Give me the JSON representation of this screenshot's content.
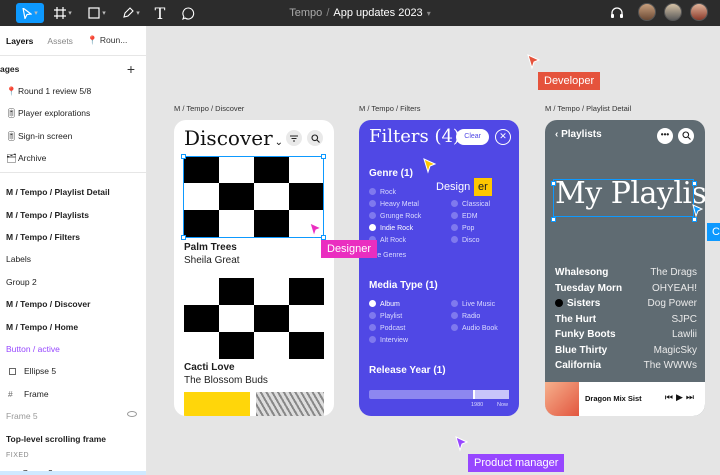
{
  "toolbar": {
    "project": "Tempo",
    "file": "App updates 2023",
    "text_tool": "T"
  },
  "left_panel": {
    "tabs": [
      "Layers",
      "Assets",
      "Roun..."
    ],
    "pages_label": "ages",
    "pages": [
      {
        "icon": "📍",
        "label": "Round 1 review 5/8"
      },
      {
        "icon": "🎚",
        "label": "Player explorations"
      },
      {
        "icon": "🎚",
        "label": "Sign-in screen"
      },
      {
        "icon": "🗂",
        "label": "Archive"
      }
    ],
    "layers": [
      {
        "label": "M / Tempo / Playlist Detail",
        "style": "bold"
      },
      {
        "label": "M / Tempo / Playlists",
        "style": "bold"
      },
      {
        "label": "M / Tempo / Filters",
        "style": "bold"
      },
      {
        "label": "Labels",
        "style": "normal"
      },
      {
        "label": "Group 2",
        "style": "normal"
      },
      {
        "label": "M / Tempo / Discover",
        "style": "bold"
      },
      {
        "label": "M / Tempo / Home",
        "style": "bold"
      },
      {
        "label": "Button / active",
        "style": "purple"
      },
      {
        "label": "Ellipse 5",
        "style": "normal"
      },
      {
        "label": "Frame",
        "style": "normal"
      },
      {
        "label": "Frame 5",
        "style": "grey"
      },
      {
        "label": "Top-level scrolling frame",
        "style": "hdr"
      },
      {
        "label": "FIXED",
        "style": "small"
      },
      {
        "label": "Group 2",
        "style": "normal"
      }
    ]
  },
  "canvas": {
    "frame_labels": [
      "M / Tempo / Discover",
      "M / Tempo / Filters",
      "M / Tempo / Playlist Detail"
    ],
    "discover": {
      "title": "Discover",
      "songs": [
        {
          "title": "Palm Trees",
          "artist": "Sheila Great"
        },
        {
          "title": "Cacti Love",
          "artist": "The Blossom Buds"
        }
      ]
    },
    "filters": {
      "title": "Filters (4)",
      "clear": "Clear",
      "genre_title": "Genre (1)",
      "genre_left": [
        "Rock",
        "Heavy Metal",
        "Grunge Rock",
        "Indie Rock",
        "Alt Rock"
      ],
      "genre_right": [
        "Classical",
        "EDM",
        "Pop",
        "Disco"
      ],
      "more_genres": "re Genres",
      "media_title": "Media Type (1)",
      "media_left": [
        "Album",
        "Playlist",
        "Podcast",
        "Interview"
      ],
      "media_right": [
        "Live Music",
        "Radio",
        "Audio Book"
      ],
      "release_title": "Release Year (1)",
      "slider_low": "1980",
      "slider_high": "Now"
    },
    "playlist": {
      "back": "Playlists",
      "more": "•••",
      "title": "My Playlist",
      "tracks": [
        {
          "title": "Whalesong",
          "artist": "The Drags"
        },
        {
          "title": "Tuesday Morn",
          "artist": "OHYEAH!"
        },
        {
          "title": "Sisters",
          "artist": "Dog Power"
        },
        {
          "title": "The Hurt",
          "artist": "SJPC"
        },
        {
          "title": "Funky Boots",
          "artist": "Lawlii"
        },
        {
          "title": "Blue Thirty",
          "artist": "MagicSky"
        },
        {
          "title": "California",
          "artist": "The WWWs"
        }
      ],
      "now_playing": "Dragon Mix Sist",
      "controls": "⏮▶⏭"
    },
    "cursors": {
      "developer": "Developer",
      "designer_pink": "Designer",
      "designer_yellow": "Design",
      "designer_yellow_cut": "er",
      "product_manager": "Product manager",
      "blue_cut": "C"
    }
  },
  "colors": {
    "accent": "#0d99ff",
    "filters_bg": "#5048e5",
    "playlist_bg": "#5f6b72",
    "developer": "#e5533c",
    "designer": "#ea2ec0",
    "designer_yellow": "#ffc700",
    "product_manager": "#9747ff"
  }
}
